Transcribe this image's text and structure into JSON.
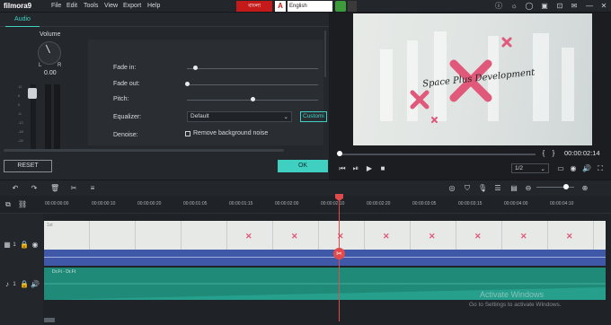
{
  "app": {
    "logo": "filmora9",
    "menu": [
      "File",
      "Edit",
      "Tools",
      "View",
      "Export",
      "Help"
    ]
  },
  "ime": {
    "bangla_label": "বাংলা",
    "keyboard_letter": "A",
    "language": "English"
  },
  "audio_panel": {
    "tab_label": "Audio",
    "volume_label": "Volume",
    "left_label": "L",
    "right_label": "R",
    "volume_value": "0.00",
    "meter_scale": [
      "12",
      "6",
      "0",
      "-6",
      "-12",
      "-18",
      "-24"
    ],
    "rows": {
      "fade_in": "Fade in:",
      "fade_out": "Fade out:",
      "pitch": "Pitch:",
      "equalizer": "Equalizer:",
      "denoise": "Denoise:"
    },
    "levels": {
      "fade_in": 0.06,
      "fade_out": 0.0,
      "pitch": 0.5
    },
    "equalizer_value": "Default",
    "custom_label": "Customi",
    "denoise_checkbox_label": "Remove background noise",
    "denoise_checked": false,
    "reset_label": "RESET",
    "ok_label": "OK"
  },
  "preview": {
    "title_text": "Space Plus Development",
    "timecode": "00:00:02:14",
    "zoom": "1/2",
    "progress": 0.01,
    "accent_pink": "#e0587a"
  },
  "timeline": {
    "zoom_level": 0.7,
    "ruler_labels": [
      "00:00:00:00",
      "00:00:00:10",
      "00:00:00:20",
      "00:00:01:05",
      "00:00:01:15",
      "00:00:02:00",
      "00:00:02:10",
      "00:00:02:20",
      "00:00:03:05",
      "00:00:03:15",
      "00:00:04:00",
      "00:00:04:10"
    ],
    "video_clip_label": "1st",
    "audio_clip_label": "Dr.Ft - Dr.Ft",
    "track_video_num": "1",
    "track_audio_num": "1"
  },
  "watermark": {
    "line1": "Activate Windows",
    "line2": "Go to Settings to activate Windows."
  }
}
